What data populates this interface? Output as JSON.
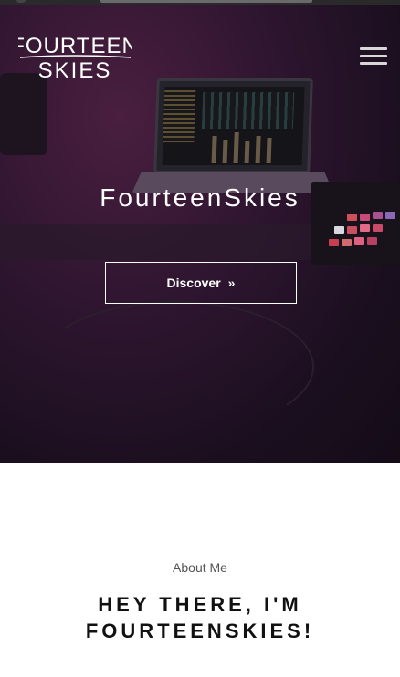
{
  "brand": {
    "logo_line1": "FOURTEEN",
    "logo_line2": "SKIES"
  },
  "nav": {
    "menu_icon": "hamburger-icon"
  },
  "hero": {
    "title": "FourteenSkies",
    "cta_label": "Discover",
    "cta_icon": "double-chevron-right-icon"
  },
  "about": {
    "kicker": "About Me",
    "heading_line1": "HEY THERE, I'M",
    "heading_line2": "FOURTEENSKIES!"
  },
  "colors": {
    "hero_tint": "#2e1530",
    "text_on_hero": "#ffffff",
    "heading": "#111111",
    "kicker": "#555555"
  }
}
